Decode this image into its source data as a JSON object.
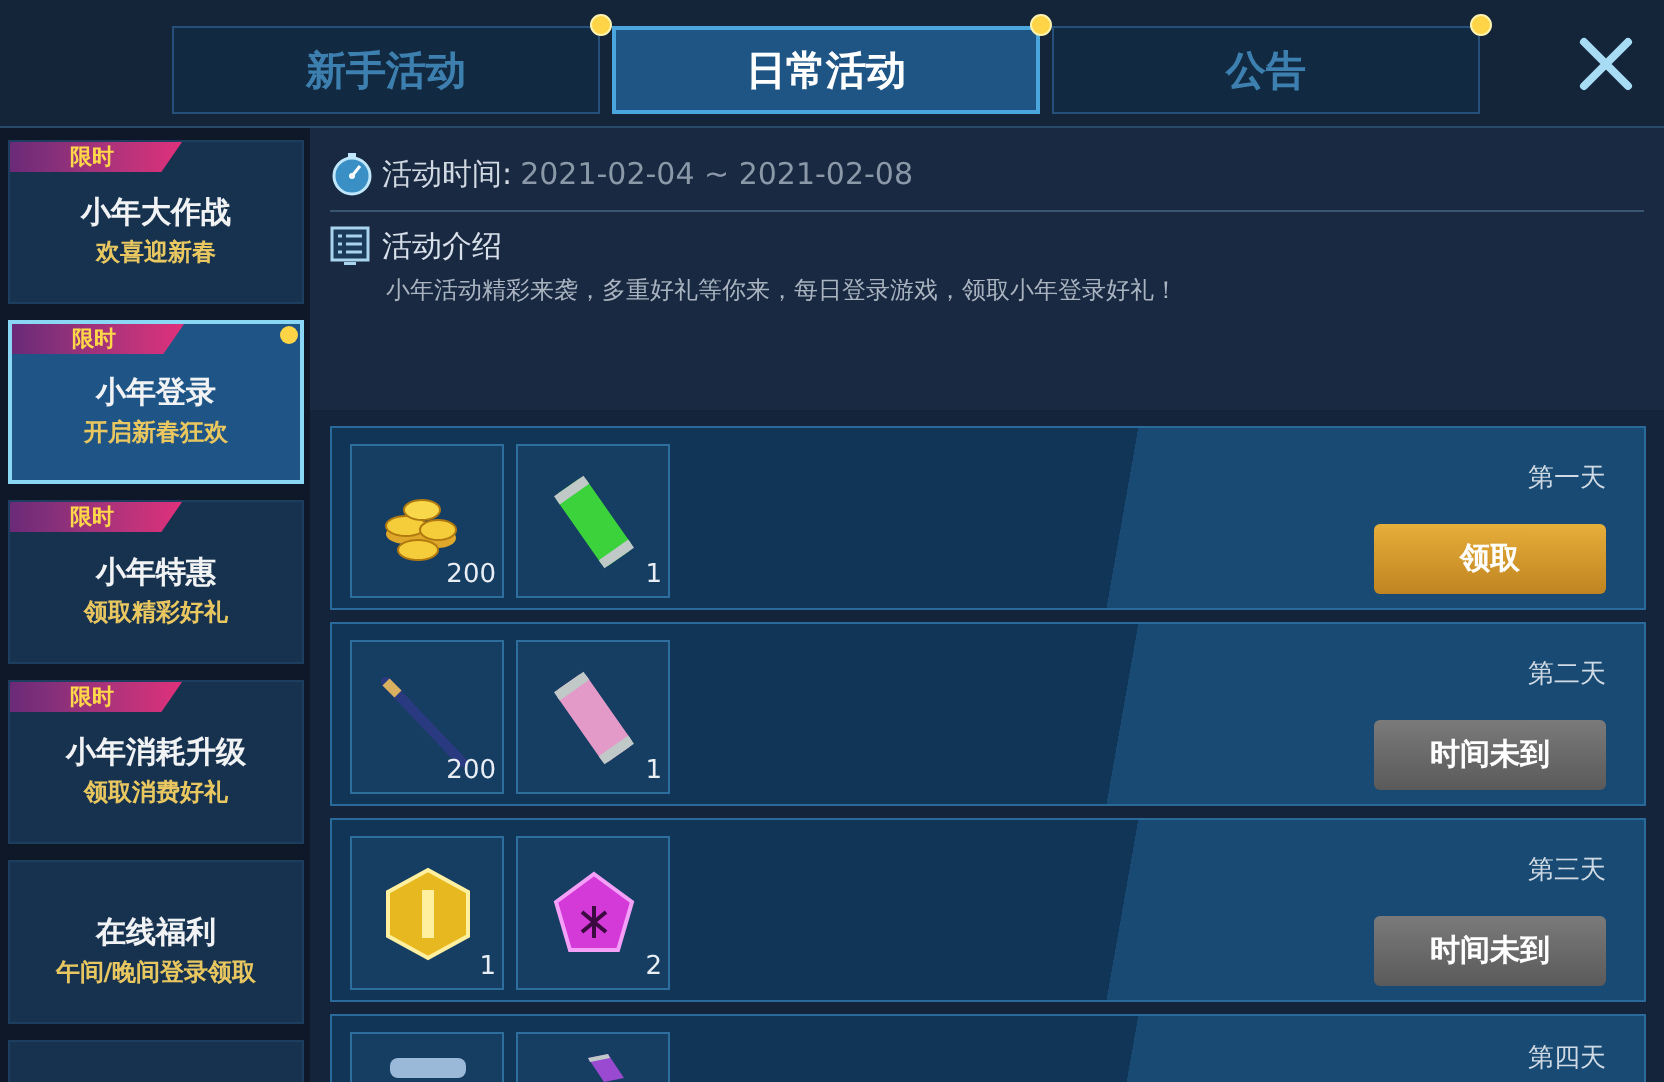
{
  "tabs": [
    {
      "label": "新手活动",
      "selected": false,
      "dot": true
    },
    {
      "label": "日常活动",
      "selected": true,
      "dot": true
    },
    {
      "label": "公告",
      "selected": false,
      "dot": true
    }
  ],
  "sidebar": {
    "items": [
      {
        "tag": "限时",
        "title": "小年大作战",
        "subtitle": "欢喜迎新春",
        "selected": false,
        "dot": false
      },
      {
        "tag": "限时",
        "title": "小年登录",
        "subtitle": "开启新春狂欢",
        "selected": true,
        "dot": true
      },
      {
        "tag": "限时",
        "title": "小年特惠",
        "subtitle": "领取精彩好礼",
        "selected": false,
        "dot": false
      },
      {
        "tag": "限时",
        "title": "小年消耗升级",
        "subtitle": "领取消费好礼",
        "selected": false,
        "dot": false
      },
      {
        "title": "在线福利",
        "subtitle": "午间/晚间登录领取",
        "selected": false,
        "dot": false
      }
    ]
  },
  "info": {
    "time_label": "活动时间:",
    "time_value": "2021-02-04 ~ 2021-02-08",
    "intro_title": "活动介绍",
    "intro_text": "小年活动精彩来袭，多重好礼等你来，每日登录游戏，领取小年登录好礼！"
  },
  "rewards": [
    {
      "day": "第一天",
      "items": [
        {
          "kind": "coins",
          "count": "200"
        },
        {
          "kind": "green-canister",
          "count": "1"
        }
      ],
      "button": {
        "label": "领取",
        "enabled": true
      }
    },
    {
      "day": "第二天",
      "items": [
        {
          "kind": "pen",
          "count": "200"
        },
        {
          "kind": "pink-canister",
          "count": "1"
        }
      ],
      "button": {
        "label": "时间未到",
        "enabled": false
      }
    },
    {
      "day": "第三天",
      "items": [
        {
          "kind": "medal",
          "count": "1"
        },
        {
          "kind": "gem",
          "count": "2"
        }
      ],
      "button": {
        "label": "时间未到",
        "enabled": false
      }
    },
    {
      "day": "第四天",
      "items": [
        {
          "kind": "scroll"
        },
        {
          "kind": "purple-canister"
        }
      ]
    }
  ]
}
